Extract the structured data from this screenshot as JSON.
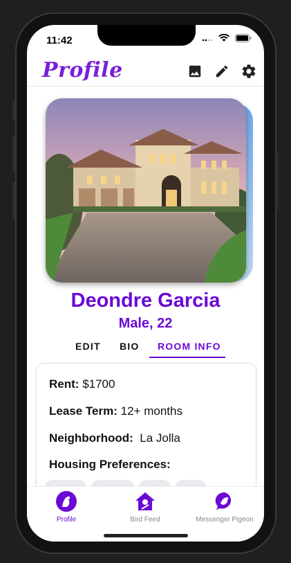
{
  "status": {
    "time": "11:42"
  },
  "header": {
    "title": "Profile",
    "icons": [
      "image-icon",
      "pencil-icon",
      "gear-icon"
    ]
  },
  "profile": {
    "name": "Deondre Garcia",
    "gender_age": "Male, 22"
  },
  "tabs": [
    {
      "label": "EDIT",
      "active": false
    },
    {
      "label": "BIO",
      "active": false
    },
    {
      "label": "ROOM INFO",
      "active": true
    }
  ],
  "room_info": {
    "rent_label": "Rent:",
    "rent_value": "$1700",
    "lease_label": "Lease Term:",
    "lease_value": "12+ months",
    "neighborhood_label": "Neighborhood:",
    "neighborhood_value": "La Jolla",
    "preferences_label": "Housing Preferences:"
  },
  "tabbar": {
    "items": [
      {
        "label": "Profile",
        "icon": "bird-icon",
        "active": true
      },
      {
        "label": "Bird Feed",
        "icon": "birdhouse-icon",
        "active": false
      },
      {
        "label": "Messenger Pigeon",
        "icon": "pigeon-chat-icon",
        "active": false
      }
    ]
  },
  "colors": {
    "accent": "#6b0ad6",
    "inactive": "#888888"
  }
}
